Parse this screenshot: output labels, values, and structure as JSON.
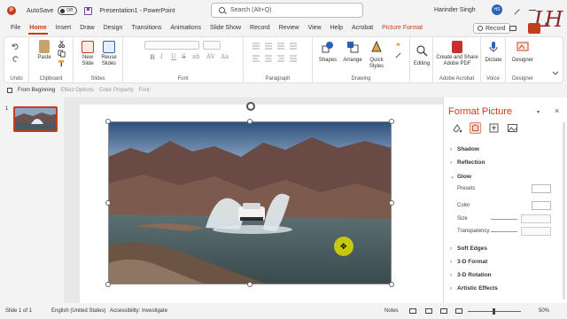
{
  "titlebar": {
    "app_logo": "P",
    "autosave_label": "AutoSave",
    "autosave_state": "Off",
    "document_title": "Presentation1  -  PowerPoint",
    "search_placeholder": "Search (Alt+Q)",
    "user_name": "Harinder Singh",
    "avatar_initials": "HS"
  },
  "tabs": [
    "File",
    "Home",
    "Insert",
    "Draw",
    "Design",
    "Transitions",
    "Animations",
    "Slide Show",
    "Record",
    "Review",
    "View",
    "Help",
    "Acrobat",
    "Picture Format"
  ],
  "record_button": "Record",
  "ribbon": {
    "groups": {
      "undo": "Undo",
      "clipboard": "Clipboard",
      "slides": "Slides",
      "font": "Font",
      "paragraph": "Paragraph",
      "drawing": "Drawing",
      "adobe": "Adobe Acrobat",
      "voice": "Voice",
      "designer": "Designer"
    },
    "buttons": {
      "paste": "Paste",
      "new_slide": "New Slide",
      "reuse_slides": "Reuse Slides",
      "shapes": "Shapes",
      "arrange": "Arrange",
      "quick_styles": "Quick Styles",
      "editing": "Editing",
      "create_share_pdf": "Create and Share Adobe PDF",
      "dictate": "Dictate",
      "designer": "Designer"
    },
    "format_letters": [
      "B",
      "I",
      "U",
      "S",
      "ab",
      "AV",
      "Aa"
    ]
  },
  "cmdbar": {
    "from_beginning": "From Beginning",
    "effect_options": "Effect Options",
    "color_property": "Color Property",
    "font_label": "Font:"
  },
  "slide_pane": {
    "slide_number": "1"
  },
  "format_pane": {
    "title": "Format Picture",
    "sections": {
      "shadow": "Shadow",
      "reflection": "Reflection",
      "glow": "Glow",
      "soft_edges": "Soft Edges",
      "format_3d": "3-D Format",
      "rotation_3d": "3-D Rotation",
      "artistic_effects": "Artistic Effects"
    },
    "glow_fields": {
      "presets": "Presets",
      "color": "Color",
      "size": "Size",
      "transparency": "Transparency"
    }
  },
  "statusbar": {
    "slide_info": "Slide 1 of 1",
    "language": "English (United States)",
    "accessibility": "Accessibility: Investigate",
    "notes": "Notes",
    "zoom": "50%"
  },
  "colors": {
    "accent": "#c43e1c",
    "selected_handle": "#ffffff"
  }
}
